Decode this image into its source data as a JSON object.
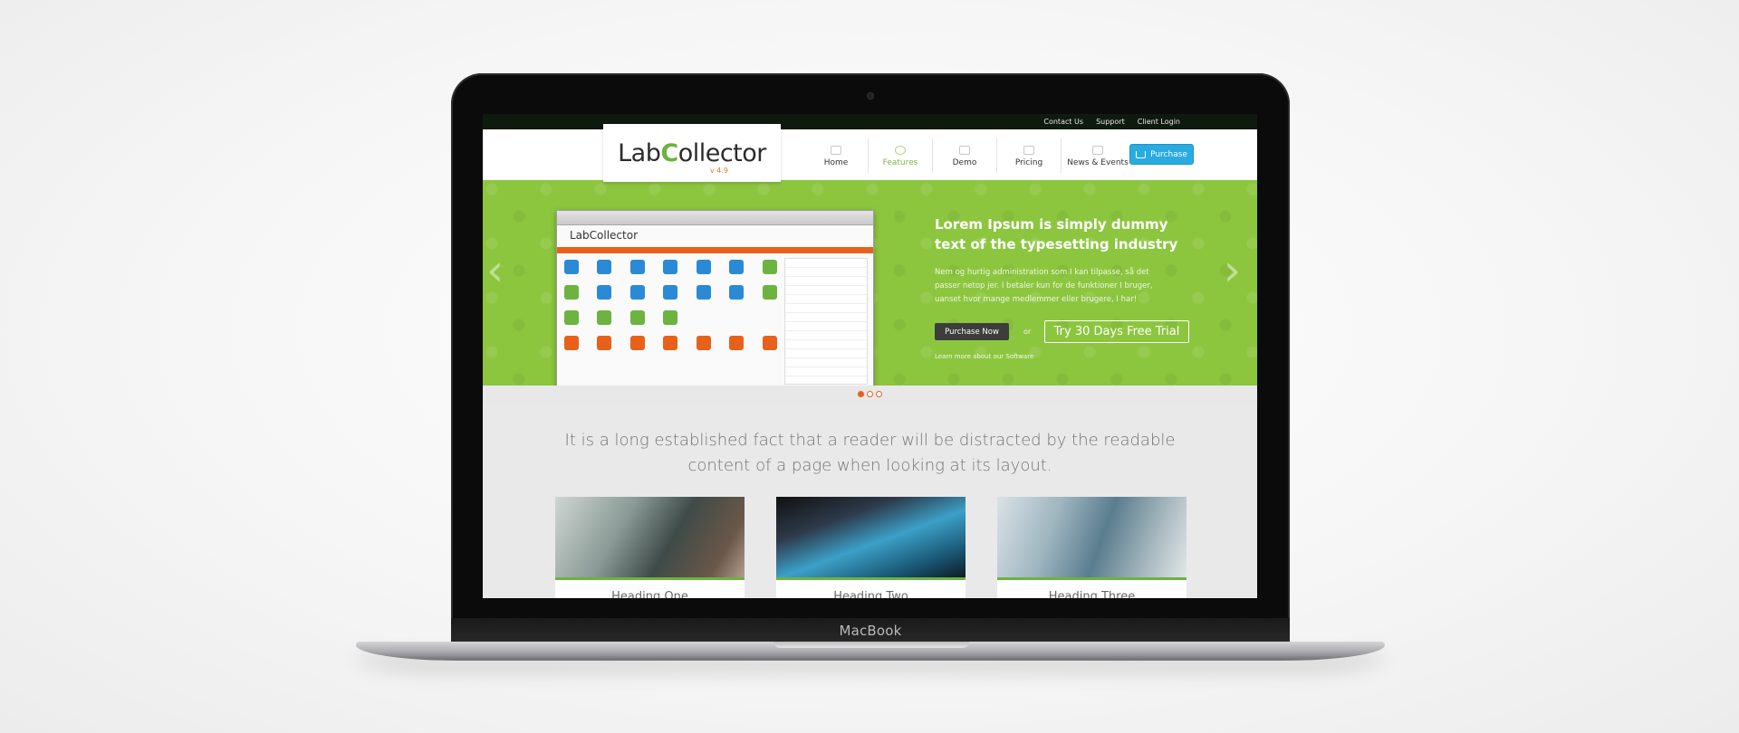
{
  "device": {
    "brand_label": "MacBook"
  },
  "topbar": {
    "links": [
      "Contact Us",
      "Support",
      "Client Login"
    ]
  },
  "logo": {
    "name_part1": "Lab",
    "name_part2": "C",
    "name_part3": "ollector",
    "version": "v 4.9"
  },
  "nav": {
    "items": [
      {
        "label": "Home",
        "icon": "home-icon"
      },
      {
        "label": "Features",
        "icon": "gear-icon",
        "active": true
      },
      {
        "label": "Demo",
        "icon": "monitor-icon"
      },
      {
        "label": "Pricing",
        "icon": "tag-icon"
      },
      {
        "label": "News & Events",
        "icon": "document-icon"
      }
    ],
    "purchase_label": "Purchase"
  },
  "hero": {
    "title": "Lorem Ipsum is simply dummy text of the typesetting industry",
    "body": "Nem og hurtig administration som I kan tilpasse, så det passer netop jer. I betaler kun for de funktioner I bruger, uanset hvor mange medlemmer eller brugere, I har!",
    "buy_label": "Purchase Now",
    "or_label": "or",
    "trial_label": "Try 30 Days Free Trial",
    "learn_label": "Learn more about our Software",
    "app_logo": "LabCollector",
    "slide_count": 3,
    "active_slide": 1
  },
  "content": {
    "lead": "It is a long established fact that a reader will be distracted by the readable content of a page when looking at its layout.",
    "cards": [
      {
        "title": "Heading One"
      },
      {
        "title": "Heading Two"
      },
      {
        "title": "Heading Three"
      }
    ]
  },
  "colors": {
    "accent_green": "#8cc63f",
    "accent_orange": "#e8611a",
    "button_blue": "#29abe2"
  }
}
